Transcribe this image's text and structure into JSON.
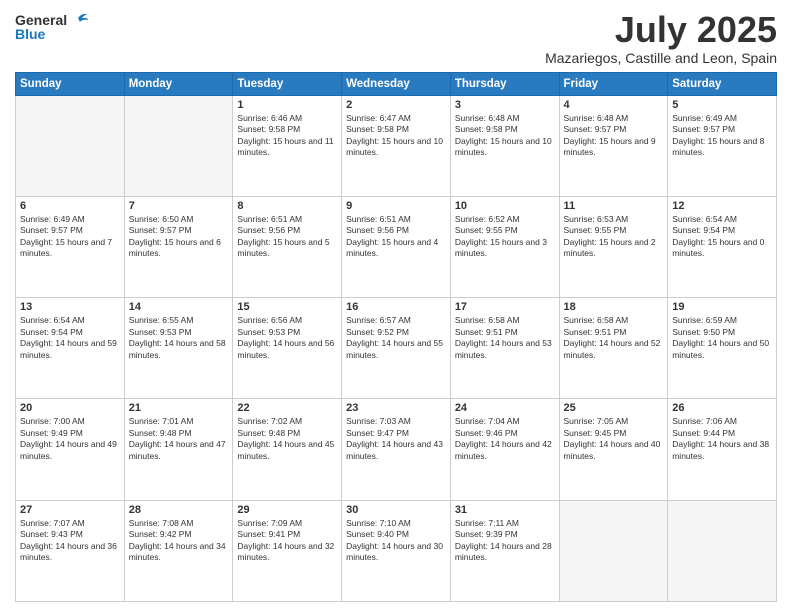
{
  "logo": {
    "general": "General",
    "blue": "Blue"
  },
  "title": "July 2025",
  "subtitle": "Mazariegos, Castille and Leon, Spain",
  "weekdays": [
    "Sunday",
    "Monday",
    "Tuesday",
    "Wednesday",
    "Thursday",
    "Friday",
    "Saturday"
  ],
  "weeks": [
    [
      {
        "day": "",
        "sunrise": "",
        "sunset": "",
        "daylight": ""
      },
      {
        "day": "",
        "sunrise": "",
        "sunset": "",
        "daylight": ""
      },
      {
        "day": "1",
        "sunrise": "Sunrise: 6:46 AM",
        "sunset": "Sunset: 9:58 PM",
        "daylight": "Daylight: 15 hours and 11 minutes."
      },
      {
        "day": "2",
        "sunrise": "Sunrise: 6:47 AM",
        "sunset": "Sunset: 9:58 PM",
        "daylight": "Daylight: 15 hours and 10 minutes."
      },
      {
        "day": "3",
        "sunrise": "Sunrise: 6:48 AM",
        "sunset": "Sunset: 9:58 PM",
        "daylight": "Daylight: 15 hours and 10 minutes."
      },
      {
        "day": "4",
        "sunrise": "Sunrise: 6:48 AM",
        "sunset": "Sunset: 9:57 PM",
        "daylight": "Daylight: 15 hours and 9 minutes."
      },
      {
        "day": "5",
        "sunrise": "Sunrise: 6:49 AM",
        "sunset": "Sunset: 9:57 PM",
        "daylight": "Daylight: 15 hours and 8 minutes."
      }
    ],
    [
      {
        "day": "6",
        "sunrise": "Sunrise: 6:49 AM",
        "sunset": "Sunset: 9:57 PM",
        "daylight": "Daylight: 15 hours and 7 minutes."
      },
      {
        "day": "7",
        "sunrise": "Sunrise: 6:50 AM",
        "sunset": "Sunset: 9:57 PM",
        "daylight": "Daylight: 15 hours and 6 minutes."
      },
      {
        "day": "8",
        "sunrise": "Sunrise: 6:51 AM",
        "sunset": "Sunset: 9:56 PM",
        "daylight": "Daylight: 15 hours and 5 minutes."
      },
      {
        "day": "9",
        "sunrise": "Sunrise: 6:51 AM",
        "sunset": "Sunset: 9:56 PM",
        "daylight": "Daylight: 15 hours and 4 minutes."
      },
      {
        "day": "10",
        "sunrise": "Sunrise: 6:52 AM",
        "sunset": "Sunset: 9:55 PM",
        "daylight": "Daylight: 15 hours and 3 minutes."
      },
      {
        "day": "11",
        "sunrise": "Sunrise: 6:53 AM",
        "sunset": "Sunset: 9:55 PM",
        "daylight": "Daylight: 15 hours and 2 minutes."
      },
      {
        "day": "12",
        "sunrise": "Sunrise: 6:54 AM",
        "sunset": "Sunset: 9:54 PM",
        "daylight": "Daylight: 15 hours and 0 minutes."
      }
    ],
    [
      {
        "day": "13",
        "sunrise": "Sunrise: 6:54 AM",
        "sunset": "Sunset: 9:54 PM",
        "daylight": "Daylight: 14 hours and 59 minutes."
      },
      {
        "day": "14",
        "sunrise": "Sunrise: 6:55 AM",
        "sunset": "Sunset: 9:53 PM",
        "daylight": "Daylight: 14 hours and 58 minutes."
      },
      {
        "day": "15",
        "sunrise": "Sunrise: 6:56 AM",
        "sunset": "Sunset: 9:53 PM",
        "daylight": "Daylight: 14 hours and 56 minutes."
      },
      {
        "day": "16",
        "sunrise": "Sunrise: 6:57 AM",
        "sunset": "Sunset: 9:52 PM",
        "daylight": "Daylight: 14 hours and 55 minutes."
      },
      {
        "day": "17",
        "sunrise": "Sunrise: 6:58 AM",
        "sunset": "Sunset: 9:51 PM",
        "daylight": "Daylight: 14 hours and 53 minutes."
      },
      {
        "day": "18",
        "sunrise": "Sunrise: 6:58 AM",
        "sunset": "Sunset: 9:51 PM",
        "daylight": "Daylight: 14 hours and 52 minutes."
      },
      {
        "day": "19",
        "sunrise": "Sunrise: 6:59 AM",
        "sunset": "Sunset: 9:50 PM",
        "daylight": "Daylight: 14 hours and 50 minutes."
      }
    ],
    [
      {
        "day": "20",
        "sunrise": "Sunrise: 7:00 AM",
        "sunset": "Sunset: 9:49 PM",
        "daylight": "Daylight: 14 hours and 49 minutes."
      },
      {
        "day": "21",
        "sunrise": "Sunrise: 7:01 AM",
        "sunset": "Sunset: 9:48 PM",
        "daylight": "Daylight: 14 hours and 47 minutes."
      },
      {
        "day": "22",
        "sunrise": "Sunrise: 7:02 AM",
        "sunset": "Sunset: 9:48 PM",
        "daylight": "Daylight: 14 hours and 45 minutes."
      },
      {
        "day": "23",
        "sunrise": "Sunrise: 7:03 AM",
        "sunset": "Sunset: 9:47 PM",
        "daylight": "Daylight: 14 hours and 43 minutes."
      },
      {
        "day": "24",
        "sunrise": "Sunrise: 7:04 AM",
        "sunset": "Sunset: 9:46 PM",
        "daylight": "Daylight: 14 hours and 42 minutes."
      },
      {
        "day": "25",
        "sunrise": "Sunrise: 7:05 AM",
        "sunset": "Sunset: 9:45 PM",
        "daylight": "Daylight: 14 hours and 40 minutes."
      },
      {
        "day": "26",
        "sunrise": "Sunrise: 7:06 AM",
        "sunset": "Sunset: 9:44 PM",
        "daylight": "Daylight: 14 hours and 38 minutes."
      }
    ],
    [
      {
        "day": "27",
        "sunrise": "Sunrise: 7:07 AM",
        "sunset": "Sunset: 9:43 PM",
        "daylight": "Daylight: 14 hours and 36 minutes."
      },
      {
        "day": "28",
        "sunrise": "Sunrise: 7:08 AM",
        "sunset": "Sunset: 9:42 PM",
        "daylight": "Daylight: 14 hours and 34 minutes."
      },
      {
        "day": "29",
        "sunrise": "Sunrise: 7:09 AM",
        "sunset": "Sunset: 9:41 PM",
        "daylight": "Daylight: 14 hours and 32 minutes."
      },
      {
        "day": "30",
        "sunrise": "Sunrise: 7:10 AM",
        "sunset": "Sunset: 9:40 PM",
        "daylight": "Daylight: 14 hours and 30 minutes."
      },
      {
        "day": "31",
        "sunrise": "Sunrise: 7:11 AM",
        "sunset": "Sunset: 9:39 PM",
        "daylight": "Daylight: 14 hours and 28 minutes."
      },
      {
        "day": "",
        "sunrise": "",
        "sunset": "",
        "daylight": ""
      },
      {
        "day": "",
        "sunrise": "",
        "sunset": "",
        "daylight": ""
      }
    ]
  ]
}
